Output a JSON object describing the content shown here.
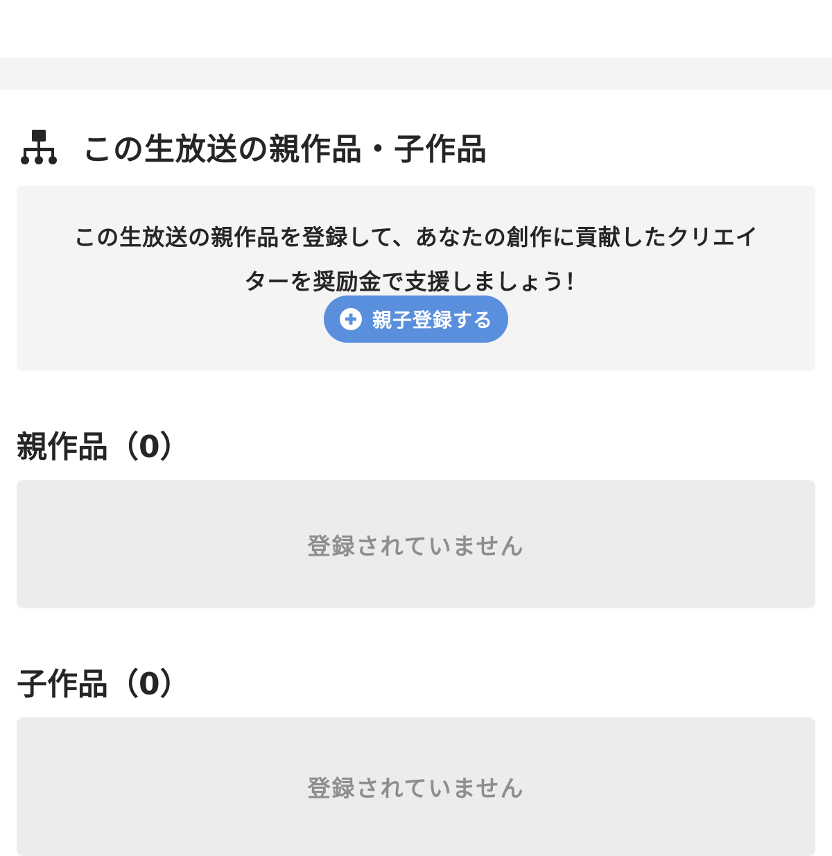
{
  "section": {
    "title": "この生放送の親作品・子作品",
    "icon": "hierarchy-tree-icon"
  },
  "info": {
    "message": "この生放送の親作品を登録して、あなたの創作に貢献したクリエイターを奨励金で支援しましょう！",
    "button_label": "親子登録する",
    "button_icon": "plus-circle-icon",
    "button_color": "#5a8fdd"
  },
  "parents": {
    "heading": "親作品（0）",
    "empty_text": "登録されていません"
  },
  "children": {
    "heading": "子作品（0）",
    "empty_text": "登録されていません"
  },
  "colors": {
    "text": "#252525",
    "muted": "#8e8e8e",
    "info_bg": "#f4f4f4",
    "empty_bg": "#ececec",
    "band_bg": "#f3f3f3"
  }
}
